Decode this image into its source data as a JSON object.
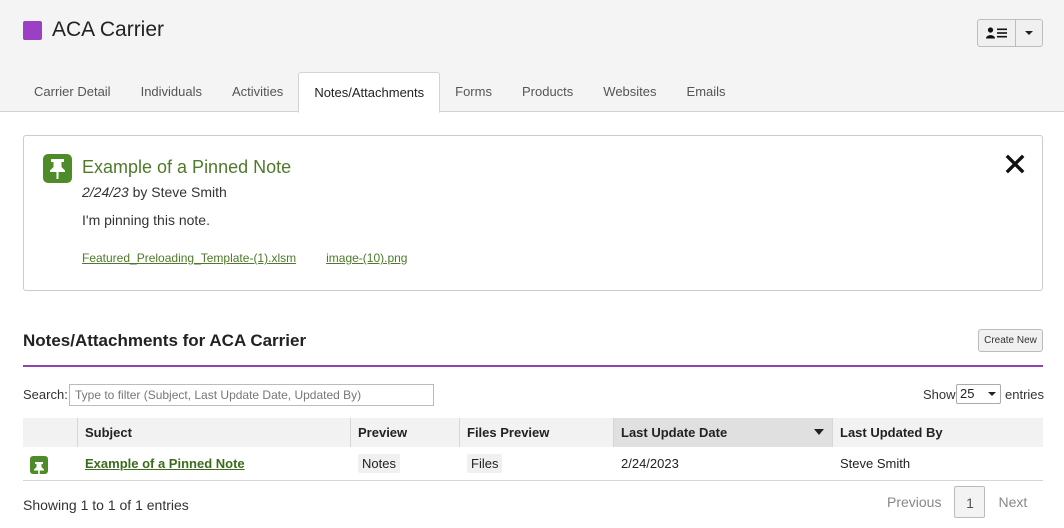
{
  "app": {
    "title": "ACA Carrier",
    "brand_color": "#9b3fc5"
  },
  "user_menu": {
    "icon": "user-list-icon",
    "dropdown_icon": "chevron-down-icon"
  },
  "tabs": [
    {
      "label": "Carrier Detail"
    },
    {
      "label": "Individuals"
    },
    {
      "label": "Activities"
    },
    {
      "label": "Notes/Attachments",
      "active": true
    },
    {
      "label": "Forms"
    },
    {
      "label": "Products"
    },
    {
      "label": "Websites"
    },
    {
      "label": "Emails"
    }
  ],
  "pinned_note": {
    "icon": "pin-icon",
    "title": "Example of a Pinned Note",
    "date": "2/24/23",
    "by": "by Steve Smith",
    "body": "I'm pinning this note.",
    "files": [
      "Featured_Preloading_Template-(1).xlsm",
      "image-(10).png"
    ],
    "close_icon": "close-icon",
    "accent_color": "#4e8c2a"
  },
  "section": {
    "title": "Notes/Attachments for ACA Carrier",
    "create_label": "Create New",
    "rule_color": "#8e44ad"
  },
  "search": {
    "label": "Search:",
    "placeholder": "Type to filter (Subject, Last Update Date, Updated By)"
  },
  "page_size": {
    "show_label": "Show",
    "value": "25",
    "entries_label": "entries"
  },
  "table": {
    "columns": [
      "",
      "Subject",
      "Preview",
      "Files Preview",
      "Last Update Date",
      "Last Updated By"
    ],
    "sorted_column": "Last Update Date",
    "rows": [
      {
        "pinned": true,
        "subject": "Example of a Pinned Note",
        "preview": "Notes",
        "files_preview": "Files",
        "last_update": "2/24/2023",
        "updated_by": "Steve Smith"
      }
    ]
  },
  "footer": {
    "info": "Showing 1 to 1 of 1 entries",
    "prev": "Previous",
    "current_page": "1",
    "next": "Next"
  }
}
